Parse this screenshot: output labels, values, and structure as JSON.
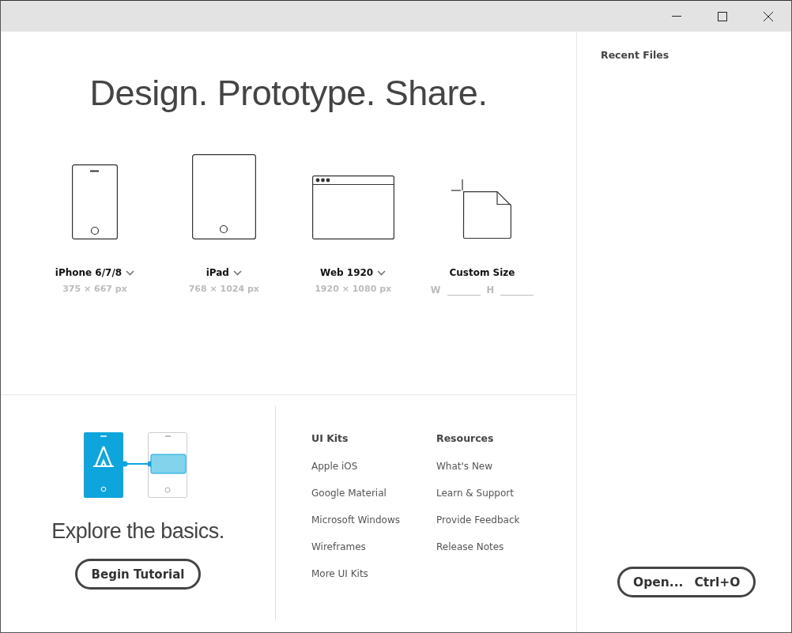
{
  "headline": "Design. Prototype. Share.",
  "presets": [
    {
      "kind": "phone",
      "label": "iPhone 6/7/8",
      "dropdown": true,
      "size": "375 × 667 px"
    },
    {
      "kind": "tablet",
      "label": "iPad",
      "dropdown": true,
      "size": "768 × 1024 px"
    },
    {
      "kind": "web",
      "label": "Web 1920",
      "dropdown": true,
      "size": "1920 × 1080 px"
    },
    {
      "kind": "custom",
      "label": "Custom Size",
      "dropdown": false,
      "width_label": "W",
      "height_label": "H"
    }
  ],
  "tutorial": {
    "title": "Explore the basics.",
    "button": "Begin Tutorial"
  },
  "link_columns": [
    {
      "heading": "UI Kits",
      "links": [
        "Apple iOS",
        "Google Material",
        "Microsoft Windows",
        "Wireframes",
        "More UI Kits"
      ]
    },
    {
      "heading": "Resources",
      "links": [
        "What's New",
        "Learn & Support",
        "Provide Feedback",
        "Release Notes"
      ]
    }
  ],
  "recent_files": {
    "heading": "Recent Files"
  },
  "open_button": {
    "label": "Open...",
    "shortcut": "Ctrl+O"
  }
}
